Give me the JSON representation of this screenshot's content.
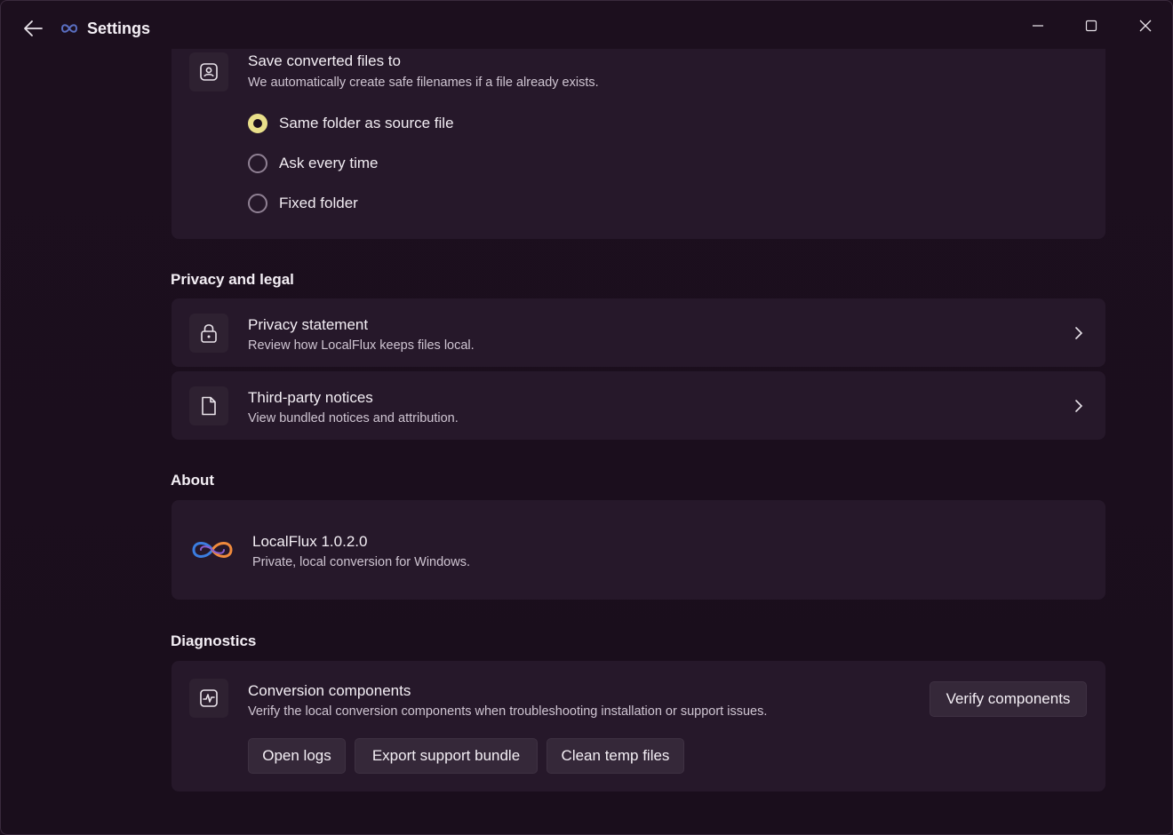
{
  "window": {
    "title": "Settings"
  },
  "save_section": {
    "title": "Save converted files to",
    "subtitle": "We automatically create safe filenames if a file already exists.",
    "options": [
      {
        "label": "Same folder as source file",
        "selected": true
      },
      {
        "label": "Ask every time",
        "selected": false
      },
      {
        "label": "Fixed folder",
        "selected": false
      }
    ]
  },
  "privacy": {
    "heading": "Privacy and legal",
    "items": [
      {
        "title": "Privacy statement",
        "subtitle": "Review how LocalFlux keeps files local.",
        "icon": "lock-icon"
      },
      {
        "title": "Third-party notices",
        "subtitle": "View bundled notices and attribution.",
        "icon": "document-icon"
      }
    ]
  },
  "about": {
    "heading": "About",
    "app_name": "LocalFlux 1.0.2.0",
    "tagline": "Private, local conversion for Windows."
  },
  "diagnostics": {
    "heading": "Diagnostics",
    "title": "Conversion components",
    "subtitle": "Verify the local conversion components when troubleshooting installation or support issues.",
    "verify_label": "Verify components",
    "buttons": [
      "Open logs",
      "Export support bundle",
      "Clean temp files"
    ]
  },
  "colors": {
    "background": "#1b0f1d",
    "card": "#26182a",
    "accent": "#e9df8a",
    "logo_blue": "#3b7de0",
    "logo_orange": "#f08a3c"
  }
}
